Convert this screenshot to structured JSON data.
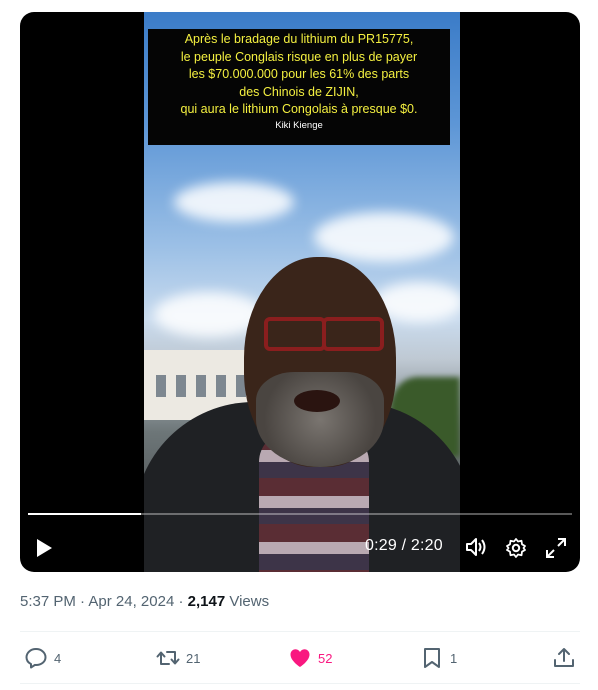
{
  "video": {
    "caption_lines": [
      "Après le bradage du lithium du PR15775,",
      "le peuple Conglais risque en plus de payer",
      "les $70.000.000 pour les 61% des parts",
      "des Chinois de ZIJIN,",
      "qui aura le lithium Congolais à presque $0."
    ],
    "caption_author": "Kiki Kienge",
    "time_display": "0:29 / 2:20",
    "progress_fraction": 0.207
  },
  "meta": {
    "time": "5:37 PM",
    "separator": "·",
    "date": "Apr 24, 2024",
    "views_count": "2,147",
    "views_label": "Views"
  },
  "actions": {
    "replies": "4",
    "reposts": "21",
    "likes": "52",
    "bookmarks": "1"
  },
  "colors": {
    "like_active": "#f91880",
    "secondary_text": "#536471",
    "caption_text": "#f4f040"
  }
}
